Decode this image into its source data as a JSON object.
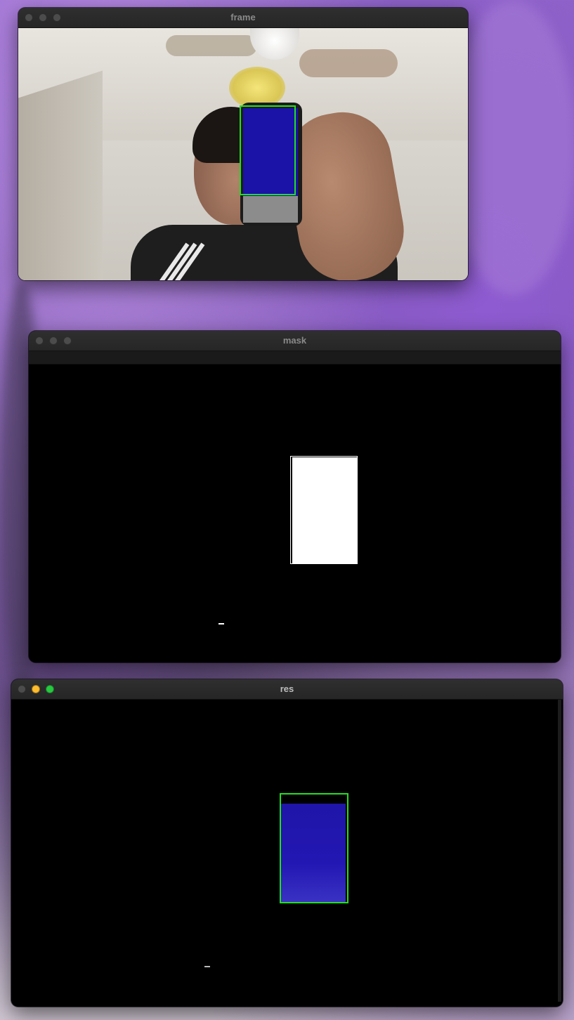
{
  "windows": {
    "frame": {
      "title": "frame"
    },
    "mask": {
      "title": "mask"
    },
    "res": {
      "title": "res"
    }
  },
  "colors": {
    "detection_box": "#22e020",
    "mask_foreground": "#ffffff",
    "detected_blue": "#1b12a8",
    "traffic_yellow": "#febc2e",
    "traffic_green": "#28c840"
  },
  "icons": {
    "close": "close-icon",
    "minimize": "minimize-icon",
    "zoom": "zoom-icon"
  }
}
